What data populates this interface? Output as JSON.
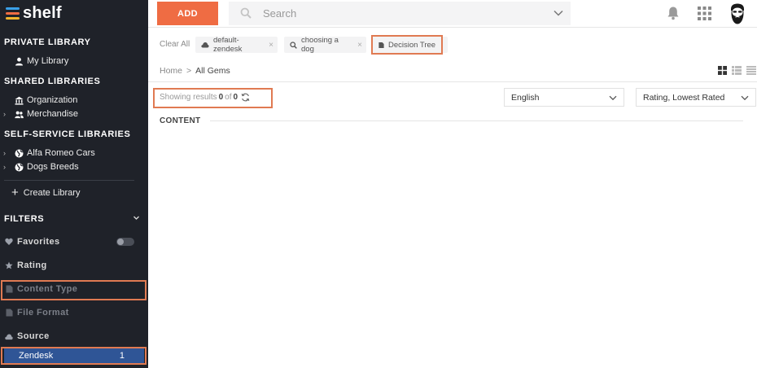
{
  "app": {
    "brand": "shelf",
    "brand_colors": [
      "#3aa0e8",
      "#ef6c43",
      "#f2b52e"
    ]
  },
  "sidebar": {
    "private_header": "PRIVATE LIBRARY",
    "my_library": "My Library",
    "shared_header": "SHARED LIBRARIES",
    "organization": "Organization",
    "merchandise": "Merchandise",
    "self_service_header": "SELF-SERVICE LIBRARIES",
    "alfa_romeo": "Alfa Romeo Cars",
    "dogs_breeds": "Dogs Breeds",
    "create_library": "Create Library",
    "filters_header": "FILTERS",
    "filters": {
      "favorites": "Favorites",
      "rating": "Rating",
      "content_type": "Content Type",
      "file_format": "File Format",
      "source": "Source"
    },
    "source_item": {
      "label": "Zendesk",
      "count": "1"
    }
  },
  "topbar": {
    "add_label": "ADD",
    "search_placeholder": "Search"
  },
  "chips": {
    "clear_all": "Clear All",
    "items": [
      "default-zendesk",
      "choosing a dog",
      "Decision Tree"
    ]
  },
  "breadcrumb": {
    "home": "Home",
    "separator": ">",
    "current": "All Gems"
  },
  "results": {
    "prefix": "Showing results",
    "shown": "0",
    "of": "of",
    "total": "0"
  },
  "language_select": "English",
  "sort_select": "Rating, Lowest Rated",
  "content_header": "CONTENT",
  "highlight_color": "#e07a52"
}
